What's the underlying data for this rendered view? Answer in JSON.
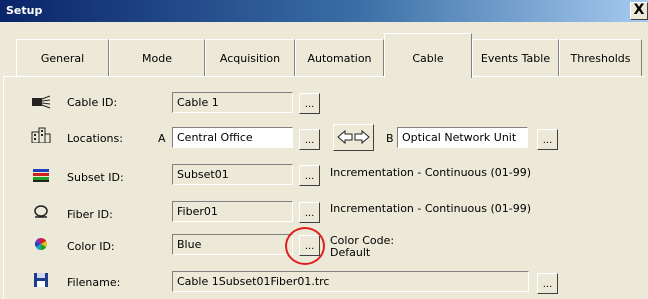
{
  "window": {
    "title": "Setup",
    "close": "X"
  },
  "tabs": [
    {
      "label": "General"
    },
    {
      "label": "Mode"
    },
    {
      "label": "Acquisition"
    },
    {
      "label": "Automation"
    },
    {
      "label": "Cable"
    },
    {
      "label": "Events Table"
    },
    {
      "label": "Thresholds"
    }
  ],
  "active_tab": "Cable",
  "browse_label": "...",
  "cable": {
    "cable_id_label": "Cable ID:",
    "cable_id_value": "Cable 1",
    "locations_label": "Locations:",
    "location_a_prefix": "A",
    "location_a_value": "Central Office",
    "location_b_prefix": "B",
    "location_b_value": "Optical Network Unit",
    "subset_id_label": "Subset ID:",
    "subset_id_value": "Subset01",
    "subset_increment": "Incrementation - Continuous (01-99)",
    "fiber_id_label": "Fiber ID:",
    "fiber_id_value": "Fiber01",
    "fiber_increment": "Incrementation - Continuous (01-99)",
    "color_id_label": "Color ID:",
    "color_id_value": "Blue",
    "color_code_label": "Color Code:",
    "color_code_value": "Default",
    "filename_label": "Filename:",
    "filename_value": "Cable 1Subset01Fiber01.trc"
  },
  "colors": {
    "highlight": "#e02020",
    "title_bar": "#0a246a"
  }
}
